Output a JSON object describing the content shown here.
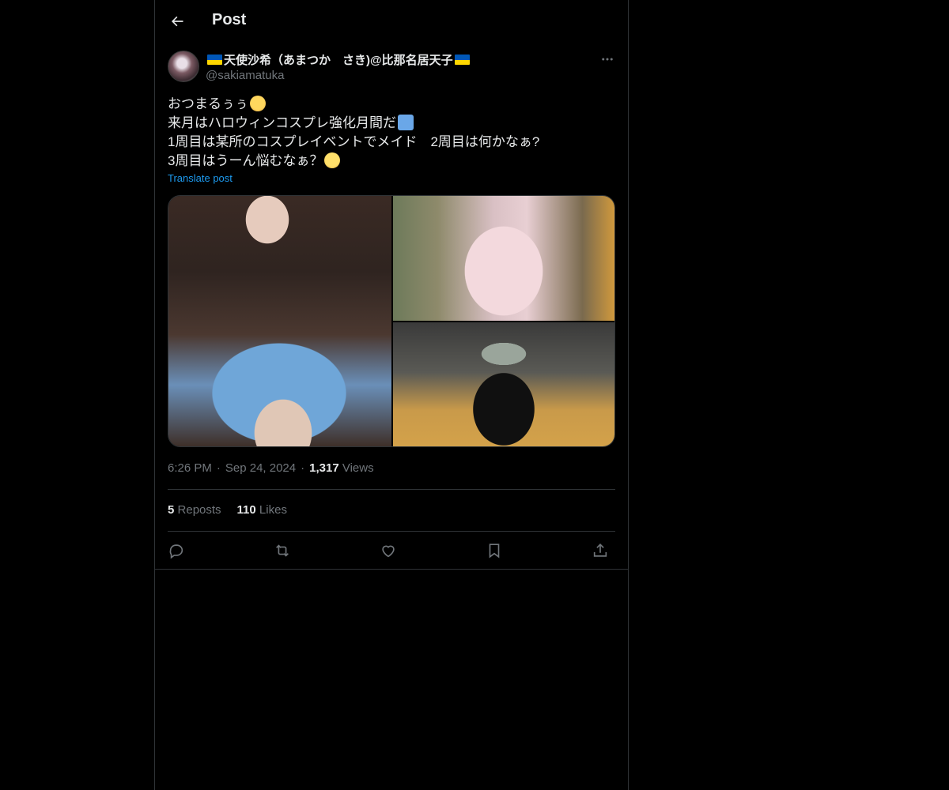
{
  "header": {
    "title": "Post"
  },
  "author": {
    "name": "天使沙希（あまつか　さき)@比那名居天子",
    "handle": "@sakiamatuka"
  },
  "post": {
    "lines": [
      "おつまるぅぅ",
      "来月はハロウィンコスプレ強化月間だ",
      "1周目は某所のコスプレイベントでメイド　2周目は何かなぁ?",
      "3周目はうーん悩むなぁ？"
    ],
    "translate": "Translate post"
  },
  "meta": {
    "time": "6:26 PM",
    "date": "Sep 24, 2024",
    "views_count": "1,317",
    "views_label": "Views"
  },
  "stats": {
    "reposts_count": "5",
    "reposts_label": "Reposts",
    "likes_count": "110",
    "likes_label": "Likes"
  },
  "colors": {
    "background": "#000000",
    "text": "#e7e9ea",
    "muted": "#71767b",
    "link": "#1d9bf0",
    "border": "#2f3336"
  },
  "icons": [
    "back-arrow-icon",
    "more-icon",
    "reply-icon",
    "repost-icon",
    "like-icon",
    "bookmark-icon",
    "share-icon",
    "ukraine-flag-icon"
  ]
}
